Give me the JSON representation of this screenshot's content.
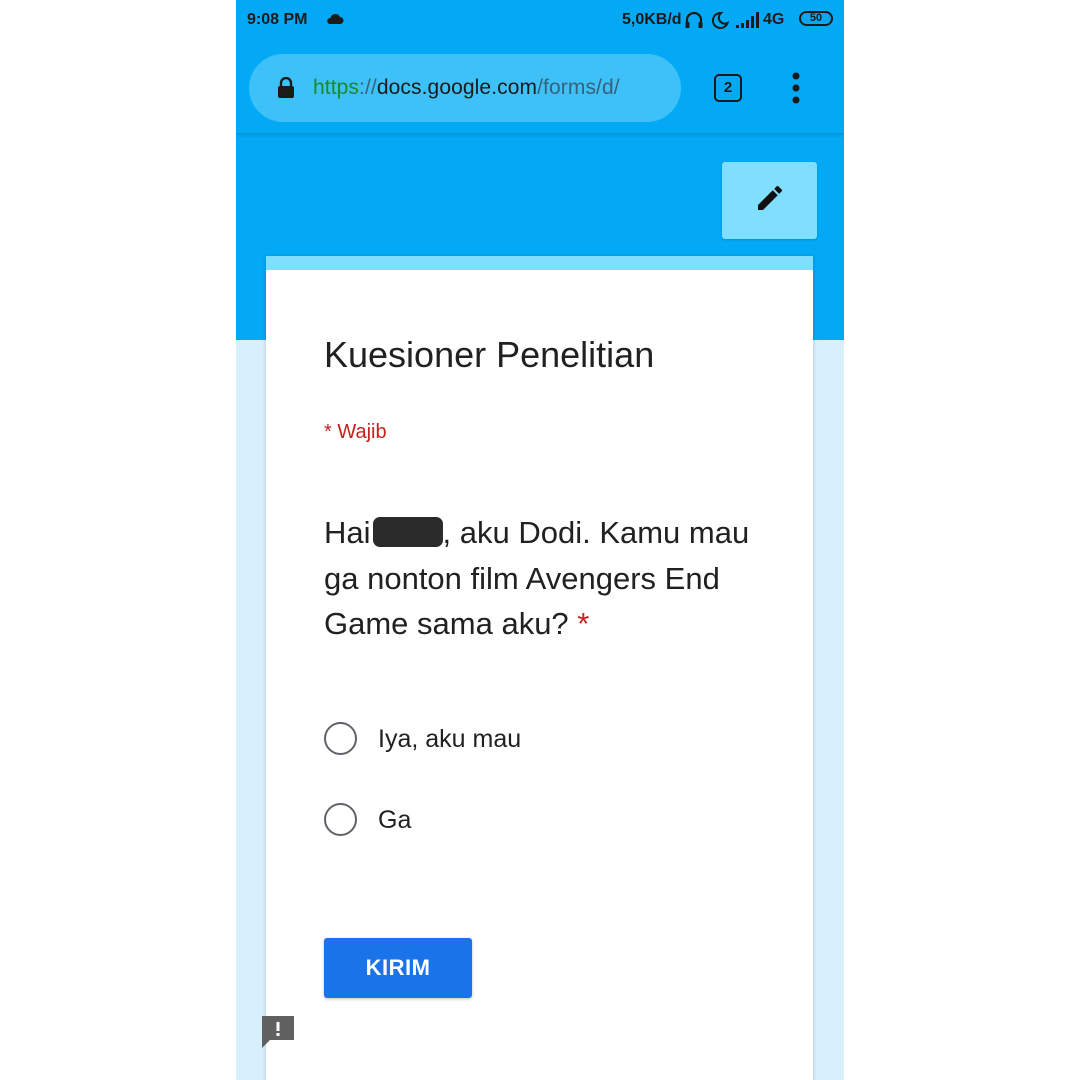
{
  "status_bar": {
    "time": "9:08 PM",
    "network_speed": "5,0KB/d",
    "network_type": "4G",
    "battery_level": "50",
    "icons": [
      "cloud-icon",
      "headphone-icon",
      "moon-icon",
      "signal-icon"
    ]
  },
  "browser": {
    "url_https": "https",
    "url_sep": "://",
    "url_host": "docs.google.com",
    "url_path": "/forms/d/",
    "tab_count": "2",
    "icons": [
      "lock-icon",
      "more-vert-icon"
    ]
  },
  "form": {
    "edit_icon": "pencil-icon",
    "title": "Kuesioner Penelitian",
    "required_note": "* Wajib",
    "question": {
      "text_before": "Hai",
      "text_after": ", aku Dodi. Kamu mau ga nonton film Avengers End Game sama aku?",
      "required_mark": "*"
    },
    "options": [
      {
        "label": "Iya, aku mau",
        "selected": false
      },
      {
        "label": "Ga",
        "selected": false
      }
    ],
    "submit_label": "KIRIM",
    "feedback_icon": "report-feedback-icon"
  },
  "colors": {
    "header_blue": "#03a9f4",
    "accent_light_blue": "#80deff",
    "page_background": "#d8f0fc",
    "submit_blue": "#1a73e8",
    "required_red": "#c5221f"
  }
}
